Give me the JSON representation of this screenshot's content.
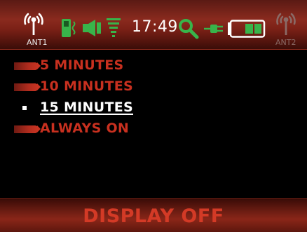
{
  "status_bar": {
    "antenna_left_label": "ANT1",
    "antenna_right_label": "ANT2",
    "time": "17:49",
    "icons": [
      "antenna-icon",
      "phone-icon",
      "speaker-icon",
      "level-icon",
      "clock",
      "search-icon",
      "plug-icon",
      "battery-icon",
      "antenna-icon"
    ],
    "battery_level": 0.5
  },
  "menu": {
    "items": [
      {
        "label": "5 MINUTES",
        "selected": false
      },
      {
        "label": "10 MINUTES",
        "selected": false
      },
      {
        "label": "15 MINUTES",
        "selected": true
      },
      {
        "label": "ALWAYS ON",
        "selected": false
      }
    ]
  },
  "footer": {
    "title": "DISPLAY OFF"
  },
  "colors": {
    "accent_red": "#c8301f",
    "green": "#38b44a",
    "selected_text": "#ffffff"
  }
}
